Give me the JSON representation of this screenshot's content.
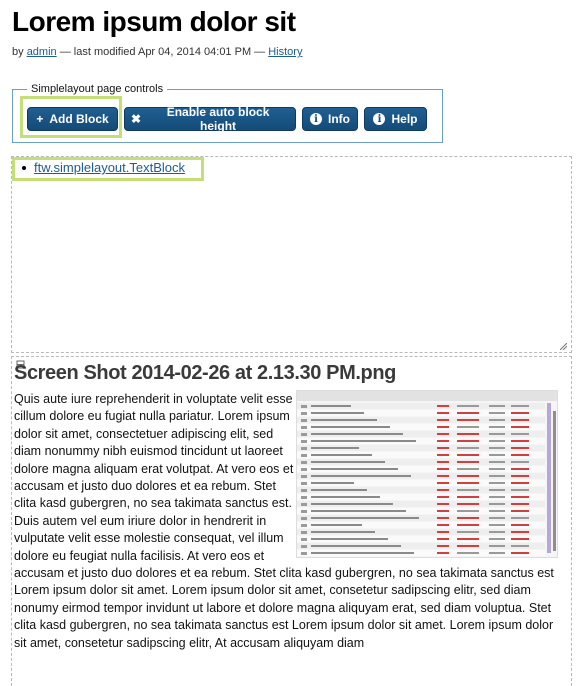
{
  "page": {
    "title": "Lorem ipsum dolor sit",
    "byline": {
      "by": "by",
      "author": "admin",
      "modified": "— last modified Apr 04, 2014 04:01 PM —",
      "history": "History"
    }
  },
  "controls": {
    "legend": "Simplelayout page controls",
    "add_block": "Add Block",
    "auto_height": "Enable auto block height",
    "info": "Info",
    "help": "Help"
  },
  "block1": {
    "items": [
      "ftw.simplelayout.TextBlock"
    ]
  },
  "block2": {
    "title": "Screen Shot 2014-02-26 at 2.13.30 PM.png",
    "text": "Quis aute iure reprehenderit in voluptate velit esse cillum dolore eu fugiat nulla pariatur. Lorem ipsum dolor sit amet, consectetuer adipiscing elit, sed diam nonummy nibh euismod tincidunt ut laoreet dolore magna aliquam erat volutpat. At vero eos et accusam et justo duo dolores et ea rebum. Stet clita kasd gubergren, no sea takimata sanctus est. Duis autem vel eum iriure dolor in hendrerit in vulputate velit esse molestie consequat, vel illum dolore eu feugiat nulla facilisis. At vero eos et accusam et justo duo dolores et ea rebum. Stet clita kasd gubergren, no sea takimata sanctus est Lorem ipsum dolor sit amet. Lorem ipsum dolor sit amet, consetetur sadipscing elitr, sed diam nonumy eirmod tempor invidunt ut labore et dolore magna aliquyam erat, sed diam voluptua. Stet clita kasd gubergren, no sea takimata sanctus est Lorem ipsum dolor sit amet. Lorem ipsum dolor sit amet, consetetur sadipscing elitr, At accusam aliquyam diam"
  },
  "colors": {
    "button": "#1a5686",
    "link": "#205c90",
    "highlight": "#c5df78",
    "fieldset_border": "#6aa1c4"
  }
}
